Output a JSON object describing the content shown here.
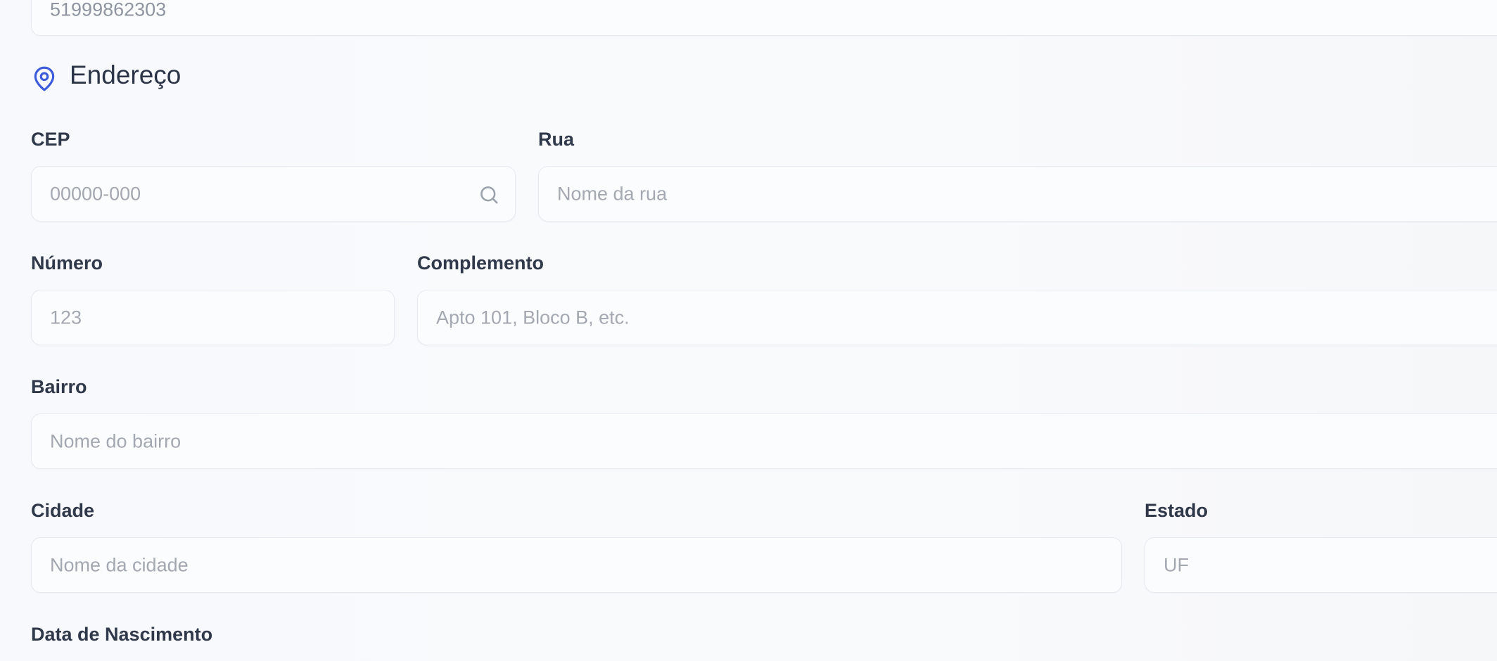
{
  "phone_field": {
    "value": "51999862303"
  },
  "section": {
    "title": "Endereço",
    "icon": "map-pin-icon",
    "accent_color": "#3b5bdb"
  },
  "fields": {
    "cep": {
      "label": "CEP",
      "placeholder": "00000-000",
      "icon": "search-icon"
    },
    "rua": {
      "label": "Rua",
      "placeholder": "Nome da rua"
    },
    "numero": {
      "label": "Número",
      "placeholder": "123"
    },
    "complemento": {
      "label": "Complemento",
      "placeholder": "Apto 101, Bloco B, etc."
    },
    "bairro": {
      "label": "Bairro",
      "placeholder": "Nome do bairro"
    },
    "cidade": {
      "label": "Cidade",
      "placeholder": "Nome da cidade"
    },
    "estado": {
      "label": "Estado",
      "placeholder": "UF"
    },
    "nascimento": {
      "label": "Data de Nascimento"
    }
  }
}
